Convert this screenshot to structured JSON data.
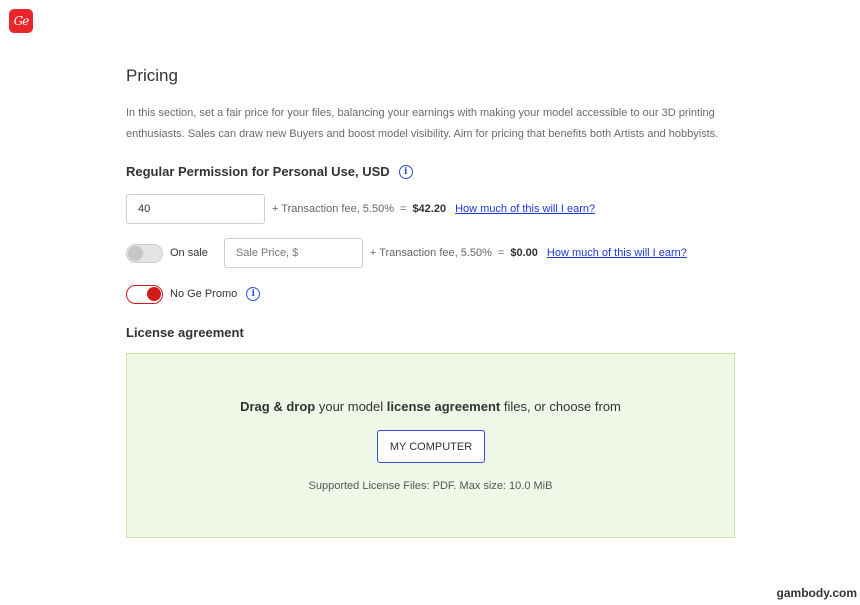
{
  "logo": {
    "text": "Ge"
  },
  "page_title": "Pricing",
  "intro": "In this section, set a fair price for your files, balancing your earnings with making your model accessible to our 3D printing enthusiasts. Sales can draw new Buyers and boost model visibility. Aim for pricing that benefits both Artists and hobbyists.",
  "regular": {
    "heading": "Regular Permission for Personal Use, USD",
    "info_glyph": "i",
    "price_value": "40",
    "fee_text": "+ Transaction fee, 5.50%",
    "equals": "=",
    "total": "$42.20",
    "earn_link": "How much of this will I earn?"
  },
  "sale": {
    "toggle_state": "off",
    "label": "On sale",
    "placeholder": "Sale Price, $",
    "fee_text": "+ Transaction fee, 5.50%",
    "equals": "=",
    "total": "$0.00",
    "earn_link": "How much of this will I earn?"
  },
  "promo": {
    "toggle_state": "on",
    "label": "No Ge Promo",
    "info_glyph": "i"
  },
  "license": {
    "heading": "License agreement",
    "drop_bold_1": "Drag & drop",
    "drop_text_1": " your model ",
    "drop_bold_2": "license agreement",
    "drop_text_2": " files, or choose from",
    "button_label": "MY COMPUTER",
    "note": "Supported License Files: PDF. Max size: 10.0 MiB"
  },
  "colors": {
    "brand_red": "#e8262c",
    "link_blue": "#1a3bd6",
    "dropzone_bg": "#f0f7e7"
  },
  "watermark": "gambody.com"
}
